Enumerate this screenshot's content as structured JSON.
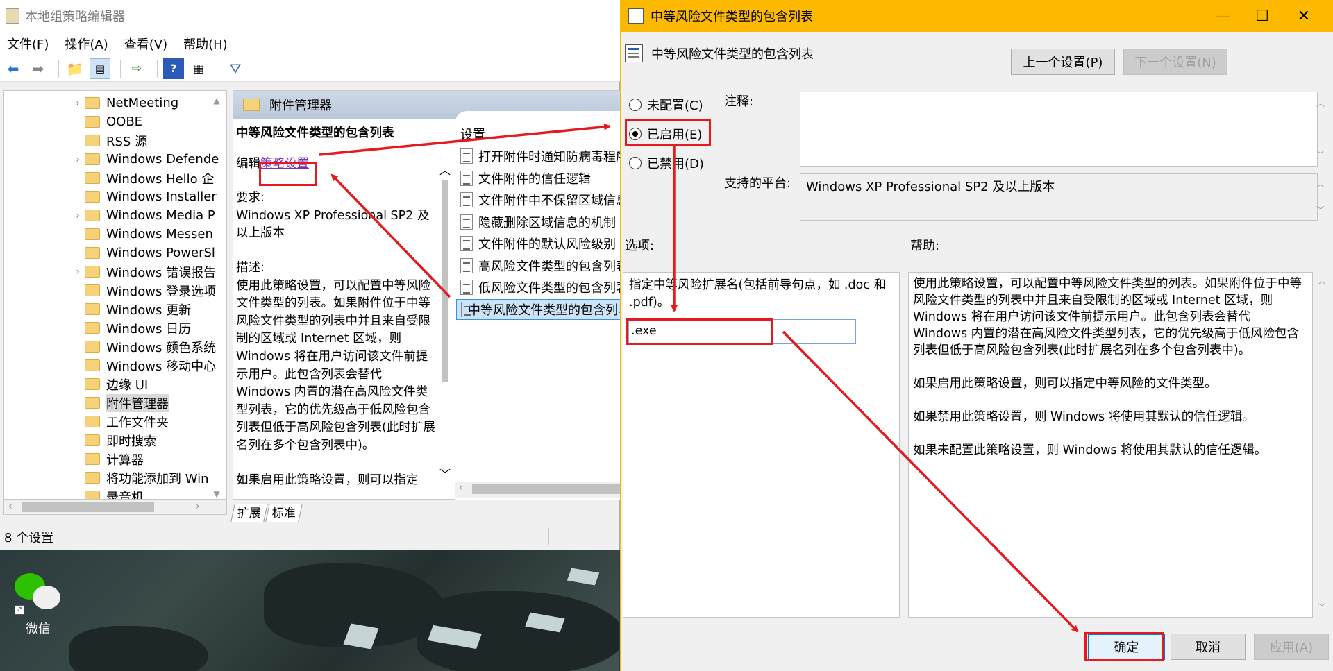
{
  "gpedit": {
    "title": "本地组策略编辑器",
    "menu": [
      "文件(F)",
      "操作(A)",
      "查看(V)",
      "帮助(H)"
    ],
    "tree_items": [
      {
        "label": "NetMeeting",
        "expandable": true
      },
      {
        "label": "OOBE",
        "expandable": false
      },
      {
        "label": "RSS 源",
        "expandable": false
      },
      {
        "label": "Windows Defende",
        "expandable": true
      },
      {
        "label": "Windows Hello 企",
        "expandable": false
      },
      {
        "label": "Windows Installer",
        "expandable": false
      },
      {
        "label": "Windows Media P",
        "expandable": true
      },
      {
        "label": "Windows Messen",
        "expandable": false
      },
      {
        "label": "Windows PowerSl",
        "expandable": false
      },
      {
        "label": "Windows 错误报告",
        "expandable": true
      },
      {
        "label": "Windows 登录选项",
        "expandable": false
      },
      {
        "label": "Windows 更新",
        "expandable": false
      },
      {
        "label": "Windows 日历",
        "expandable": false
      },
      {
        "label": "Windows 颜色系统",
        "expandable": false
      },
      {
        "label": "Windows 移动中心",
        "expandable": false
      },
      {
        "label": "边缘 UI",
        "expandable": false
      },
      {
        "label": "附件管理器",
        "expandable": false,
        "selected": true
      },
      {
        "label": "工作文件夹",
        "expandable": false
      },
      {
        "label": "即时搜索",
        "expandable": false
      },
      {
        "label": "计算器",
        "expandable": false
      },
      {
        "label": "将功能添加到 Win",
        "expandable": false
      },
      {
        "label": "录音机",
        "expandable": false
      }
    ],
    "folder_header": "附件管理器",
    "desc": {
      "title": "中等风险文件类型的包含列表",
      "edit_prefix": "编辑",
      "edit_link": "策略设置",
      "req_label": "要求:",
      "req_text": "Windows XP Professional SP2 及以上版本",
      "desc_label": "描述:",
      "desc_text": "使用此策略设置，可以配置中等风险文件类型的列表。如果附件位于中等风险文件类型的列表中并且来自受限制的区域或 Internet 区域，则 Windows 将在用户访问该文件前提示用户。此包含列表会替代 Windows 内置的潜在高风险文件类型列表，它的优先级高于低风险包含列表但低于高风险包含列表(此时扩展名列在多个包含列表中)。",
      "desc_tail": "如果启用此策略设置，则可以指定"
    },
    "settings_header": "设置",
    "settings_items": [
      "打开附件时通知防病毒程序",
      "文件附件的信任逻辑",
      "文件附件中不保留区域信息",
      "隐藏删除区域信息的机制",
      "文件附件的默认风险级别",
      "高风险文件类型的包含列表",
      "低风险文件类型的包含列表",
      "中等风险文件类型的包含列表"
    ],
    "tabs": [
      "扩展",
      "标准"
    ],
    "status": "8 个设置"
  },
  "desktop": {
    "wechat_label": "微信"
  },
  "dialog": {
    "title": "中等风险文件类型的包含列表",
    "heading": "中等风险文件类型的包含列表",
    "prev_button": "上一个设置(P)",
    "next_button": "下一个设置(N)",
    "radio_not_configured": "未配置(C)",
    "radio_enabled": "已启用(E)",
    "radio_disabled": "已禁用(D)",
    "selected_radio": "enabled",
    "comment_label": "注释:",
    "comment_value": "",
    "platform_label": "支持的平台:",
    "platform_value": "Windows XP Professional SP2 及以上版本",
    "options_label": "选项:",
    "help_label": "帮助:",
    "option_prompt": "指定中等风险扩展名(包括前导句点，如 .doc 和 .pdf)。",
    "option_value": ".exe",
    "help_paragraphs": [
      "使用此策略设置，可以配置中等风险文件类型的列表。如果附件位于中等风险文件类型的列表中并且来自受限制的区域或 Internet 区域，则 Windows 将在用户访问该文件前提示用户。此包含列表会替代 Windows 内置的潜在高风险文件类型列表，它的优先级高于低风险包含列表但低于高风险包含列表(此时扩展名列在多个包含列表中)。",
      "如果启用此策略设置，则可以指定中等风险的文件类型。",
      "如果禁用此策略设置，则 Windows 将使用其默认的信任逻辑。",
      "如果未配置此策略设置，则 Windows 将使用其默认的信任逻辑。"
    ],
    "ok_button": "确定",
    "cancel_button": "取消",
    "apply_button": "应用(A)"
  },
  "colors": {
    "annotation": "#e6191f",
    "title_bar": "#fcb900",
    "link": "#7b2fbf"
  }
}
